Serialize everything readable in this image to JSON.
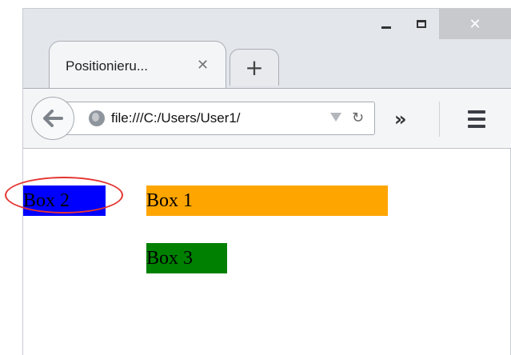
{
  "browser": {
    "tab": {
      "title": "Positionieru...",
      "close_glyph": "✕"
    },
    "new_tab_glyph": "+",
    "address_bar": {
      "url": "file:///C:/Users/User1/",
      "reload_glyph": "↻"
    },
    "overflow_glyph": "»",
    "window_controls": {
      "close_glyph": "✕"
    }
  },
  "page": {
    "boxes": [
      {
        "label": "Box 2",
        "color": "#0000ff"
      },
      {
        "label": "Box 1",
        "color": "#ffa500"
      },
      {
        "label": "Box 3",
        "color": "#008000"
      }
    ]
  },
  "annotation": {
    "color": "#e5342f",
    "target": "Box 2"
  }
}
